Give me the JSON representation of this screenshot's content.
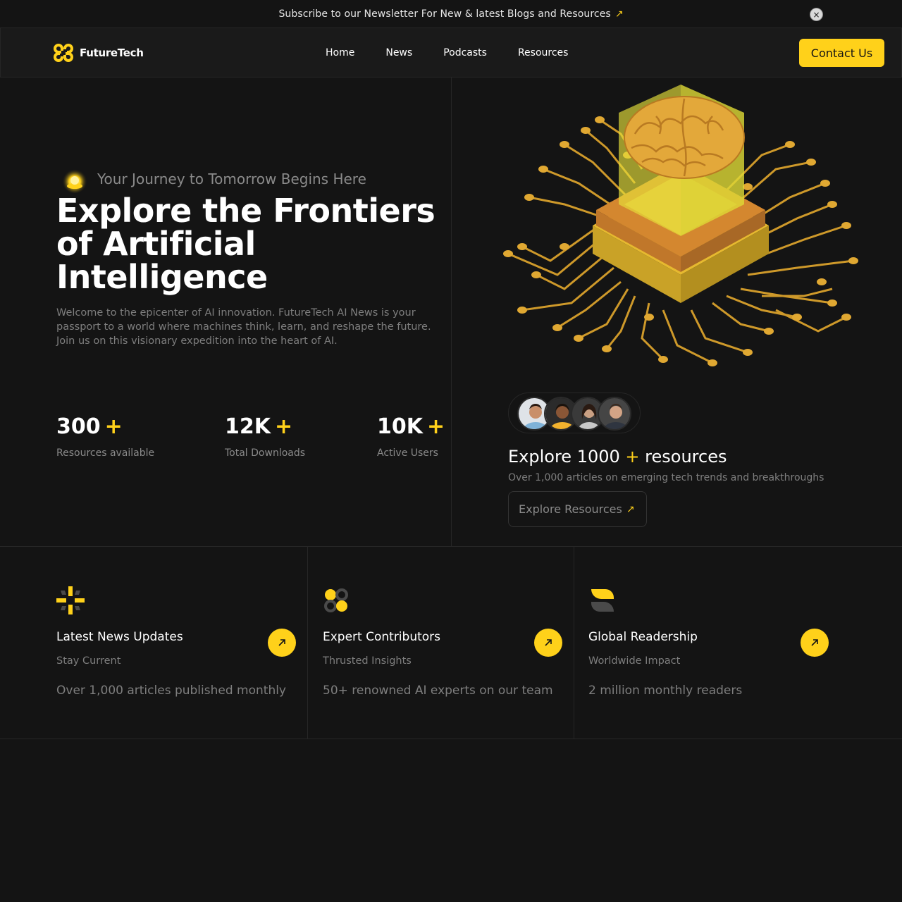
{
  "banner": {
    "text": "Subscribe to our Newsletter For New & latest Blogs and Resources",
    "arrow": "↗",
    "close": "×"
  },
  "nav": {
    "logo_text": "FutureTech",
    "links": [
      "Home",
      "News",
      "Podcasts",
      "Resources"
    ],
    "cta": "Contact Us"
  },
  "hero": {
    "tagline": "Your Journey to Tomorrow Begins Here",
    "title": "Explore the Frontiers of Artificial Intelligence",
    "description": "Welcome to the epicenter of AI innovation. FutureTech AI News is your passport to a world where machines think, learn, and reshape the future. Join us on this visionary expedition into the heart of AI.",
    "stats": [
      {
        "number": "300",
        "plus": "+",
        "label": "Resources available"
      },
      {
        "number": "12K",
        "plus": "+",
        "label": "Total Downloads"
      },
      {
        "number": "10K",
        "plus": "+",
        "label": "Active Users"
      }
    ]
  },
  "explore": {
    "title_prefix": "Explore 1000",
    "plus": "+",
    "title_suffix": "resources",
    "subtitle": "Over 1,000 articles on emerging tech trends and breakthroughs",
    "button": "Explore Resources",
    "button_arrow": "↗"
  },
  "features": [
    {
      "title": "Latest News Updates",
      "subtitle": "Stay Current",
      "description": "Over 1,000 articles published monthly",
      "icon": "sparkle-icon"
    },
    {
      "title": "Expert Contributors",
      "subtitle": "Thrusted Insights",
      "description": "50+ renowned AI experts on our team",
      "icon": "quad-circles-icon"
    },
    {
      "title": "Global Readership",
      "subtitle": "Worldwide Impact",
      "description": "2 million monthly readers",
      "icon": "leaf-icon"
    }
  ],
  "colors": {
    "accent": "#ffd11a",
    "background": "#141414",
    "border": "#262626",
    "muted": "#7e7e7e"
  }
}
